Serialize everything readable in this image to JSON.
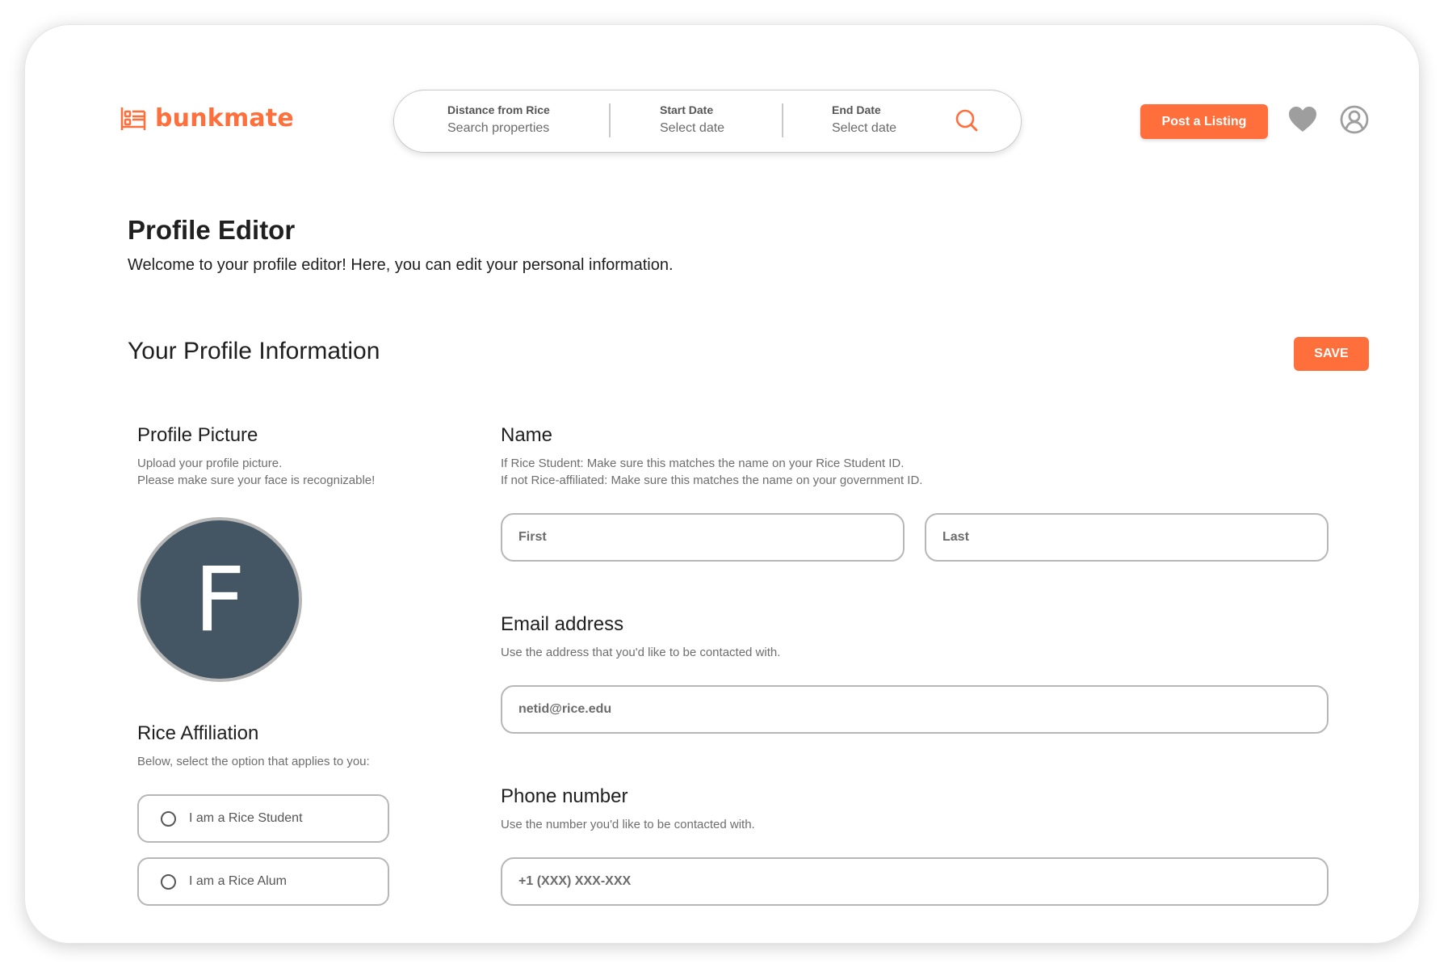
{
  "header": {
    "logo_text": "bunkmate",
    "search": {
      "distance_label": "Distance from Rice",
      "distance_value": "Search properties",
      "start_label": "Start Date",
      "start_value": "Select date",
      "end_label": "End Date",
      "end_value": "Select date"
    },
    "post_button": "Post a Listing"
  },
  "page": {
    "title": "Profile Editor",
    "subtitle": "Welcome to your profile editor! Here, you can edit your personal information.",
    "section_title": "Your Profile Information",
    "save_button": "SAVE"
  },
  "profile_picture": {
    "heading": "Profile Picture",
    "desc_line1": "Upload your profile picture.",
    "desc_line2": "Please make sure your face is recognizable!",
    "avatar_initial": "F"
  },
  "affiliation": {
    "heading": "Rice Affiliation",
    "desc": "Below, select the option that applies to you:",
    "options": [
      "I am a Rice Student",
      "I am a Rice Alum"
    ]
  },
  "name": {
    "heading": "Name",
    "desc_line1": "If Rice Student: Make sure this matches the name on your Rice Student ID.",
    "desc_line2": "If not Rice-affiliated: Make sure this matches the name on your government ID.",
    "first_placeholder": "First",
    "last_placeholder": "Last"
  },
  "email": {
    "heading": "Email address",
    "desc": "Use the address that you'd like to be contacted with.",
    "placeholder": "netid@rice.edu"
  },
  "phone": {
    "heading": "Phone number",
    "desc": "Use the number you'd like to be contacted with.",
    "placeholder": "+1 (XXX) XXX-XXX"
  },
  "colors": {
    "accent": "#ff6f3c",
    "avatar_bg": "#445663",
    "border": "#b7b7b7"
  },
  "icons": [
    "bed-logo-icon",
    "search-icon",
    "heart-icon",
    "user-circle-icon",
    "radio-icon"
  ]
}
